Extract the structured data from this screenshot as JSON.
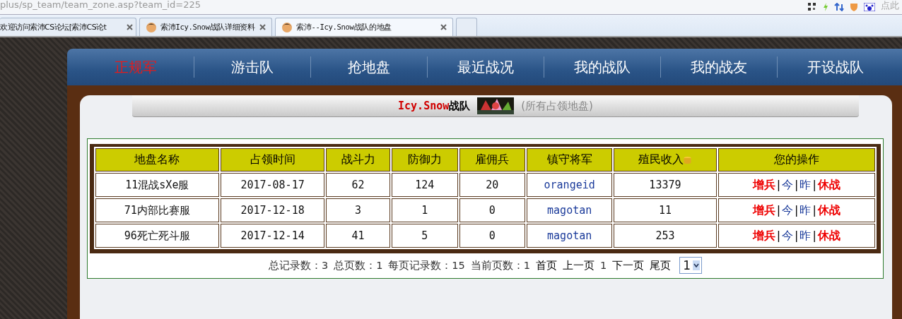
{
  "address_bar": {
    "url": "plus/sp_team/team_zone.asp?team_id=225",
    "search_hint": "点此"
  },
  "tabs": [
    {
      "label": "欢迎访问索沛CS论坛[索沛CS论t",
      "selected": false,
      "avatar": false
    },
    {
      "label": "索沛Icy.Snow战队详细资料",
      "selected": false,
      "avatar": true
    },
    {
      "label": "索沛--Icy.Snow战队的地盘",
      "selected": true,
      "avatar": true
    }
  ],
  "nav": [
    {
      "label": "正规军",
      "selected": true
    },
    {
      "label": "游击队",
      "selected": false
    },
    {
      "label": "抢地盘",
      "selected": false
    },
    {
      "label": "最近战况",
      "selected": false
    },
    {
      "label": "我的战队",
      "selected": false
    },
    {
      "label": "我的战友",
      "selected": false
    },
    {
      "label": "开设战队",
      "selected": false
    }
  ],
  "header": {
    "team_name": "Icy.Snow",
    "team_suffix": "战队",
    "subtitle": "(所有占领地盘)"
  },
  "table": {
    "columns": [
      "地盘名称",
      "占领时间",
      "战斗力",
      "防御力",
      "雇佣兵",
      "镇守将军",
      "殖民收入",
      "您的操作"
    ],
    "rows": [
      {
        "cells": [
          "11混战sXe服",
          "2017-08-17",
          "62",
          "124",
          "20",
          "orangeid",
          "13379"
        ],
        "actions": [
          {
            "label": "增兵",
            "kind": "strong"
          },
          {
            "label": "|",
            "kind": "sep"
          },
          {
            "label": "今",
            "kind": "link"
          },
          {
            "label": "|",
            "kind": "sep"
          },
          {
            "label": "昨",
            "kind": "link"
          },
          {
            "label": "|",
            "kind": "sep"
          },
          {
            "label": "休战",
            "kind": "strong"
          }
        ]
      },
      {
        "cells": [
          "71内部比赛服",
          "2017-12-18",
          "3",
          "1",
          "0",
          "magotan",
          "11"
        ],
        "actions": [
          {
            "label": "增兵",
            "kind": "strong"
          },
          {
            "label": "|",
            "kind": "sep"
          },
          {
            "label": "今",
            "kind": "link"
          },
          {
            "label": "|",
            "kind": "sep"
          },
          {
            "label": "昨",
            "kind": "link"
          },
          {
            "label": "|",
            "kind": "sep"
          },
          {
            "label": "休战",
            "kind": "strong"
          }
        ]
      },
      {
        "cells": [
          "96死亡死斗服",
          "2017-12-14",
          "41",
          "5",
          "0",
          "magotan",
          "253"
        ],
        "actions": [
          {
            "label": "增兵",
            "kind": "strong"
          },
          {
            "label": "|",
            "kind": "sep"
          },
          {
            "label": "今",
            "kind": "link"
          },
          {
            "label": "|",
            "kind": "sep"
          },
          {
            "label": "昨",
            "kind": "link"
          },
          {
            "label": "|",
            "kind": "sep"
          },
          {
            "label": "休战",
            "kind": "strong"
          }
        ]
      }
    ]
  },
  "pagination": {
    "items": [
      {
        "label": "总记录数：3",
        "kind": "text"
      },
      {
        "label": "总页数：1",
        "kind": "text"
      },
      {
        "label": "每页记录数：15",
        "kind": "text"
      },
      {
        "label": "当前页数：1",
        "kind": "text"
      },
      {
        "label": "首页",
        "kind": "link"
      },
      {
        "label": "上一页",
        "kind": "link"
      },
      {
        "label": "1",
        "kind": "text"
      },
      {
        "label": "下一页",
        "kind": "link"
      },
      {
        "label": "尾页",
        "kind": "link"
      }
    ],
    "page_select": "1"
  }
}
